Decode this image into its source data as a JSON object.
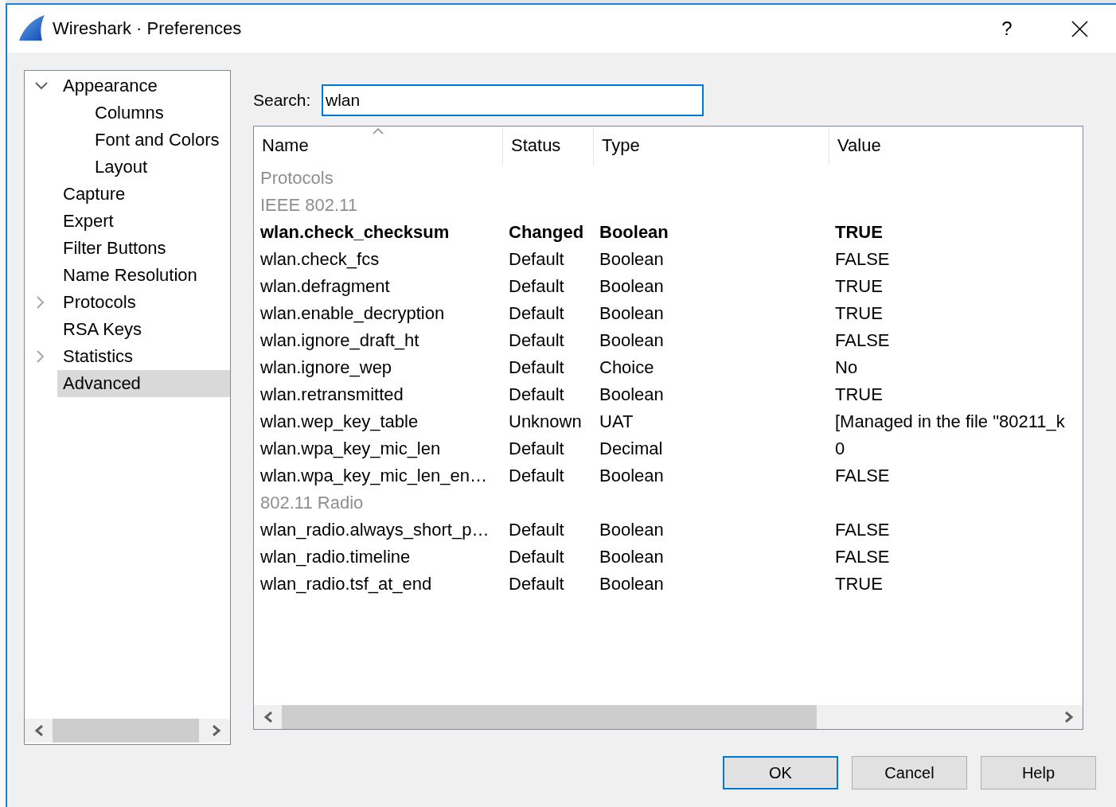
{
  "window": {
    "title": "Wireshark · Preferences",
    "help_button": "?"
  },
  "sidebar": {
    "items": [
      {
        "label": "Appearance",
        "kind": "branch",
        "expanded": true,
        "selected": false,
        "children": [
          {
            "label": "Columns",
            "kind": "leaf",
            "selected": false
          },
          {
            "label": "Font and Colors",
            "kind": "leaf",
            "selected": false
          },
          {
            "label": "Layout",
            "kind": "leaf",
            "selected": false
          }
        ]
      },
      {
        "label": "Capture",
        "kind": "leaf",
        "selected": false
      },
      {
        "label": "Expert",
        "kind": "leaf",
        "selected": false
      },
      {
        "label": "Filter Buttons",
        "kind": "leaf",
        "selected": false
      },
      {
        "label": "Name Resolution",
        "kind": "leaf",
        "selected": false
      },
      {
        "label": "Protocols",
        "kind": "branch",
        "expanded": false,
        "selected": false
      },
      {
        "label": "RSA Keys",
        "kind": "leaf",
        "selected": false
      },
      {
        "label": "Statistics",
        "kind": "branch",
        "expanded": false,
        "selected": false
      },
      {
        "label": "Advanced",
        "kind": "leaf",
        "selected": true
      }
    ]
  },
  "search": {
    "label": "Search:",
    "value": "wlan"
  },
  "table": {
    "columns": [
      {
        "label": "Name",
        "sorted": true
      },
      {
        "label": "Status",
        "sorted": false
      },
      {
        "label": "Type",
        "sorted": false
      },
      {
        "label": "Value",
        "sorted": false
      }
    ],
    "rows": [
      {
        "kind": "group",
        "name": "Protocols"
      },
      {
        "kind": "group",
        "name": "IEEE 802.11"
      },
      {
        "kind": "preference",
        "name": "wlan.check_checksum",
        "status": "Changed",
        "type": "Boolean",
        "value": "TRUE",
        "modified": true
      },
      {
        "kind": "preference",
        "name": "wlan.check_fcs",
        "status": "Default",
        "type": "Boolean",
        "value": "FALSE",
        "modified": false
      },
      {
        "kind": "preference",
        "name": "wlan.defragment",
        "status": "Default",
        "type": "Boolean",
        "value": "TRUE",
        "modified": false
      },
      {
        "kind": "preference",
        "name": "wlan.enable_decryption",
        "status": "Default",
        "type": "Boolean",
        "value": "TRUE",
        "modified": false
      },
      {
        "kind": "preference",
        "name": "wlan.ignore_draft_ht",
        "status": "Default",
        "type": "Boolean",
        "value": "FALSE",
        "modified": false
      },
      {
        "kind": "preference",
        "name": "wlan.ignore_wep",
        "status": "Default",
        "type": "Choice",
        "value": "No",
        "modified": false
      },
      {
        "kind": "preference",
        "name": "wlan.retransmitted",
        "status": "Default",
        "type": "Boolean",
        "value": "TRUE",
        "modified": false
      },
      {
        "kind": "preference",
        "name": "wlan.wep_key_table",
        "status": "Unknown",
        "type": "UAT",
        "value": "[Managed in the file \"80211_k",
        "modified": false
      },
      {
        "kind": "preference",
        "name": "wlan.wpa_key_mic_len",
        "status": "Default",
        "type": "Decimal",
        "value": "0",
        "modified": false
      },
      {
        "kind": "preference",
        "name": "wlan.wpa_key_mic_len_en…",
        "status": "Default",
        "type": "Boolean",
        "value": "FALSE",
        "modified": false
      },
      {
        "kind": "group",
        "name": "802.11 Radio"
      },
      {
        "kind": "preference",
        "name": "wlan_radio.always_short_p…",
        "status": "Default",
        "type": "Boolean",
        "value": "FALSE",
        "modified": false
      },
      {
        "kind": "preference",
        "name": "wlan_radio.timeline",
        "status": "Default",
        "type": "Boolean",
        "value": "FALSE",
        "modified": false
      },
      {
        "kind": "preference",
        "name": "wlan_radio.tsf_at_end",
        "status": "Default",
        "type": "Boolean",
        "value": "TRUE",
        "modified": false
      }
    ]
  },
  "buttons": [
    {
      "label": "OK",
      "default": true
    },
    {
      "label": "Cancel",
      "default": false
    },
    {
      "label": "Help",
      "default": false
    }
  ]
}
